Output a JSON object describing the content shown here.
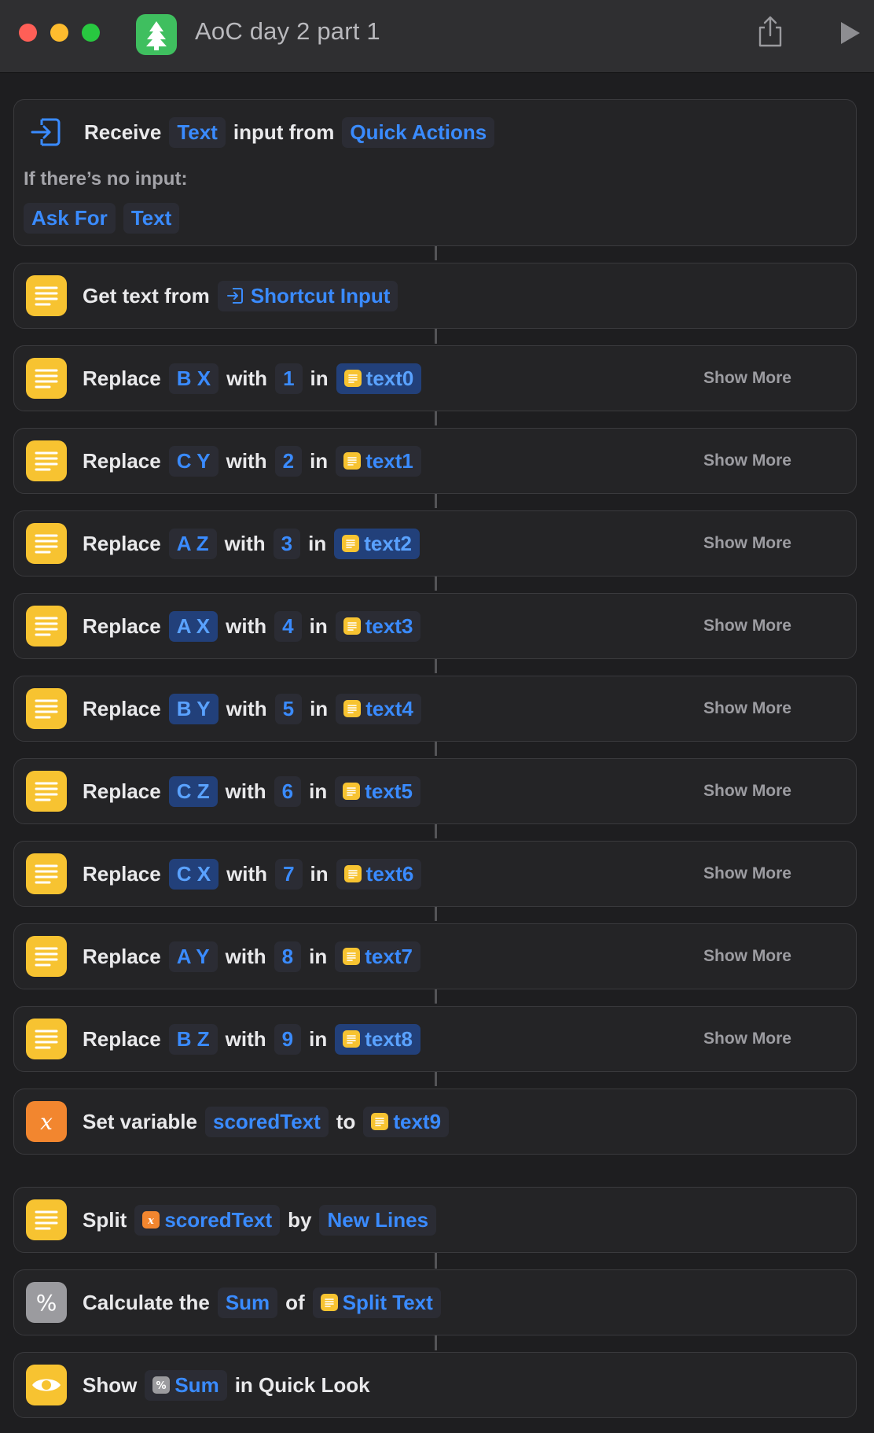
{
  "window": {
    "title": "AoC day 2 part 1",
    "app_icon": "tree-icon",
    "share_icon": "share-icon",
    "run_icon": "play-icon"
  },
  "receive": {
    "word_receive": "Receive",
    "type": "Text",
    "word_input_from": "input from",
    "source": "Quick Actions",
    "no_input_label": "If there’s no input:",
    "ask_for": "Ask For",
    "ask_type": "Text"
  },
  "get_text": {
    "label": "Get text from",
    "source": "Shortcut Input"
  },
  "replace_actions": [
    {
      "verb": "Replace",
      "find": "B X",
      "with_word": "with",
      "replacement": "1",
      "in_word": "in",
      "target": "text0",
      "show_more": "Show More"
    },
    {
      "verb": "Replace",
      "find": "C Y",
      "with_word": "with",
      "replacement": "2",
      "in_word": "in",
      "target": "text1",
      "show_more": "Show More"
    },
    {
      "verb": "Replace",
      "find": "A Z",
      "with_word": "with",
      "replacement": "3",
      "in_word": "in",
      "target": "text2",
      "show_more": "Show More"
    },
    {
      "verb": "Replace",
      "find": "A X",
      "with_word": "with",
      "replacement": "4",
      "in_word": "in",
      "target": "text3",
      "show_more": "Show More"
    },
    {
      "verb": "Replace",
      "find": "B Y",
      "with_word": "with",
      "replacement": "5",
      "in_word": "in",
      "target": "text4",
      "show_more": "Show More"
    },
    {
      "verb": "Replace",
      "find": "C Z",
      "with_word": "with",
      "replacement": "6",
      "in_word": "in",
      "target": "text5",
      "show_more": "Show More"
    },
    {
      "verb": "Replace",
      "find": "C X",
      "with_word": "with",
      "replacement": "7",
      "in_word": "in",
      "target": "text6",
      "show_more": "Show More"
    },
    {
      "verb": "Replace",
      "find": "A Y",
      "with_word": "with",
      "replacement": "8",
      "in_word": "in",
      "target": "text7",
      "show_more": "Show More"
    },
    {
      "verb": "Replace",
      "find": "B Z",
      "with_word": "with",
      "replacement": "9",
      "in_word": "in",
      "target": "text8",
      "show_more": "Show More"
    }
  ],
  "set_variable": {
    "label": "Set variable",
    "name": "scoredText",
    "to_word": "to",
    "value": "text9"
  },
  "split": {
    "label": "Split",
    "source": "scoredText",
    "by_word": "by",
    "separator": "New Lines"
  },
  "calculate": {
    "label": "Calculate the",
    "operation": "Sum",
    "of_word": "of",
    "source": "Split Text"
  },
  "show": {
    "label": "Show",
    "value": "Sum",
    "suffix": "in Quick Look"
  },
  "colors": {
    "background": "#1e1e20",
    "card": "#242426",
    "token_text": "#3a8bff",
    "action_yellow": "#f7c331",
    "action_orange": "#f2862f",
    "action_gray": "#9b9b9f"
  }
}
